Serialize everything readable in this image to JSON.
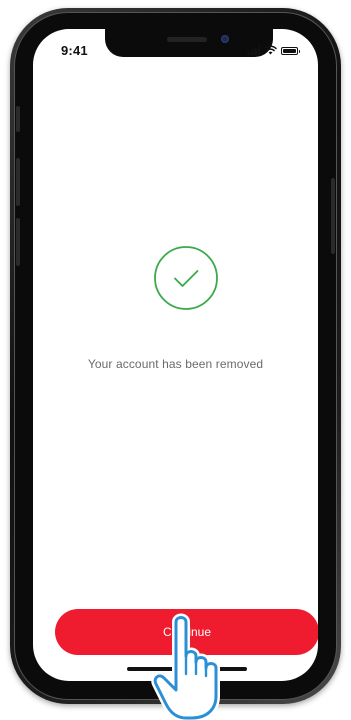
{
  "status_bar": {
    "time": "9:41",
    "icons": [
      "signal-icon",
      "wifi-icon",
      "battery-icon"
    ]
  },
  "main": {
    "success_icon": "check-circle-icon",
    "message": "Your account has been removed"
  },
  "footer": {
    "continue_label": "Continue"
  },
  "overlay": {
    "cursor_icon": "pointing-hand-icon"
  },
  "colors": {
    "accent_red": "#ee1c2e",
    "success_green": "#3aaa4a",
    "message_gray": "#6b6b6b",
    "background": "#ffffff"
  }
}
